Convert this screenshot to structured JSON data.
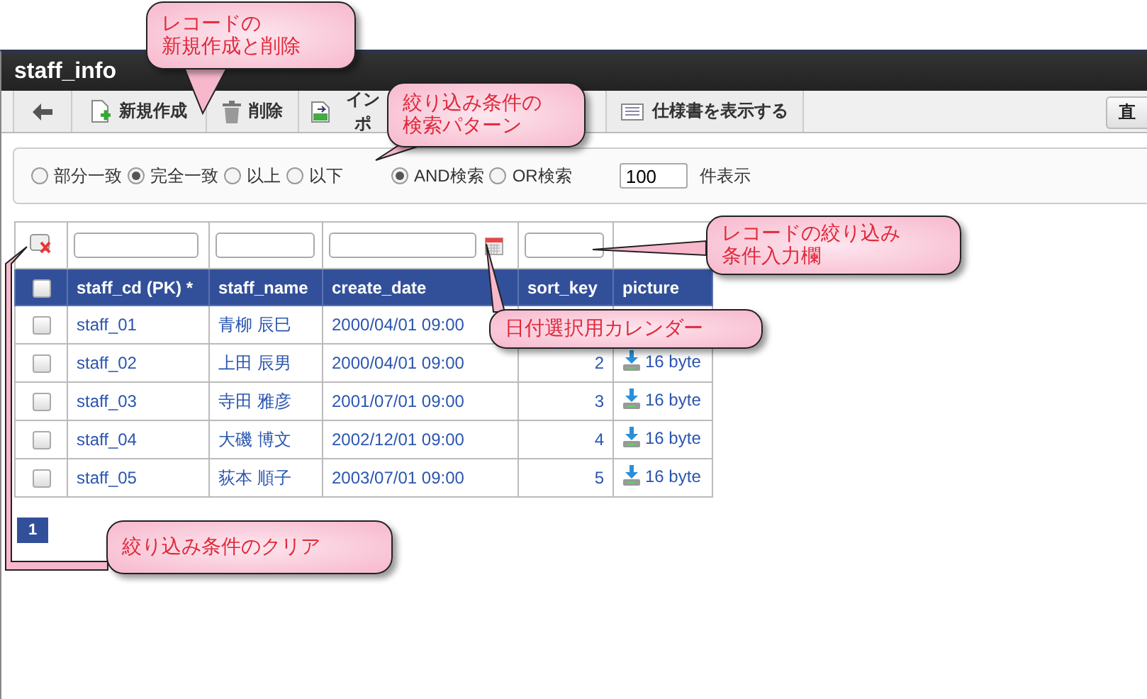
{
  "window": {
    "title": "staff_info"
  },
  "toolbar": [
    {
      "kind": "back"
    },
    {
      "kind": "new",
      "label": "新規作成"
    },
    {
      "kind": "delete",
      "label": "削除"
    },
    {
      "kind": "import",
      "label": "インポ"
    },
    {
      "kind": "spec",
      "label": "仕様書を表示する"
    }
  ],
  "toolbar_right": {
    "label": "直"
  },
  "search": {
    "match_modes": [
      {
        "label": "部分一致",
        "selected": false
      },
      {
        "label": "完全一致",
        "selected": true
      },
      {
        "label": "以上",
        "selected": false
      },
      {
        "label": "以下",
        "selected": false
      }
    ],
    "logic": [
      {
        "label": "AND検索",
        "selected": true
      },
      {
        "label": "OR検索",
        "selected": false
      }
    ],
    "count": "100",
    "count_label": "件表示"
  },
  "table": {
    "columns": [
      "staff_cd (PK) *",
      "staff_name",
      "create_date",
      "sort_key",
      "picture"
    ],
    "header_checked": false,
    "rows": [
      {
        "checked": false,
        "cells": [
          "staff_01",
          "青柳 辰巳",
          "2000/04/01 09:00",
          "",
          ""
        ]
      },
      {
        "checked": false,
        "cells": [
          "staff_02",
          "上田 辰男",
          "2000/04/01 09:00",
          "2",
          "16 byte"
        ]
      },
      {
        "checked": false,
        "cells": [
          "staff_03",
          "寺田 雅彦",
          "2001/07/01 09:00",
          "3",
          "16 byte"
        ]
      },
      {
        "checked": false,
        "cells": [
          "staff_04",
          "大磯 博文",
          "2002/12/01 09:00",
          "4",
          "16 byte"
        ]
      },
      {
        "checked": false,
        "cells": [
          "staff_05",
          "荻本 順子",
          "2003/07/01 09:00",
          "5",
          "16 byte"
        ]
      }
    ]
  },
  "pagination": [
    {
      "label": "1",
      "selected": true
    }
  ],
  "callouts": [
    {
      "lines": [
        "レコードの",
        "新規作成と削除"
      ]
    },
    {
      "lines": [
        "絞り込み条件の",
        "検索パターン"
      ]
    },
    {
      "lines": [
        "レコードの絞り込み",
        "条件入力欄"
      ]
    },
    {
      "lines": [
        "日付選択用カレンダー"
      ]
    },
    {
      "lines": [
        "絞り込み条件のクリア"
      ]
    }
  ]
}
